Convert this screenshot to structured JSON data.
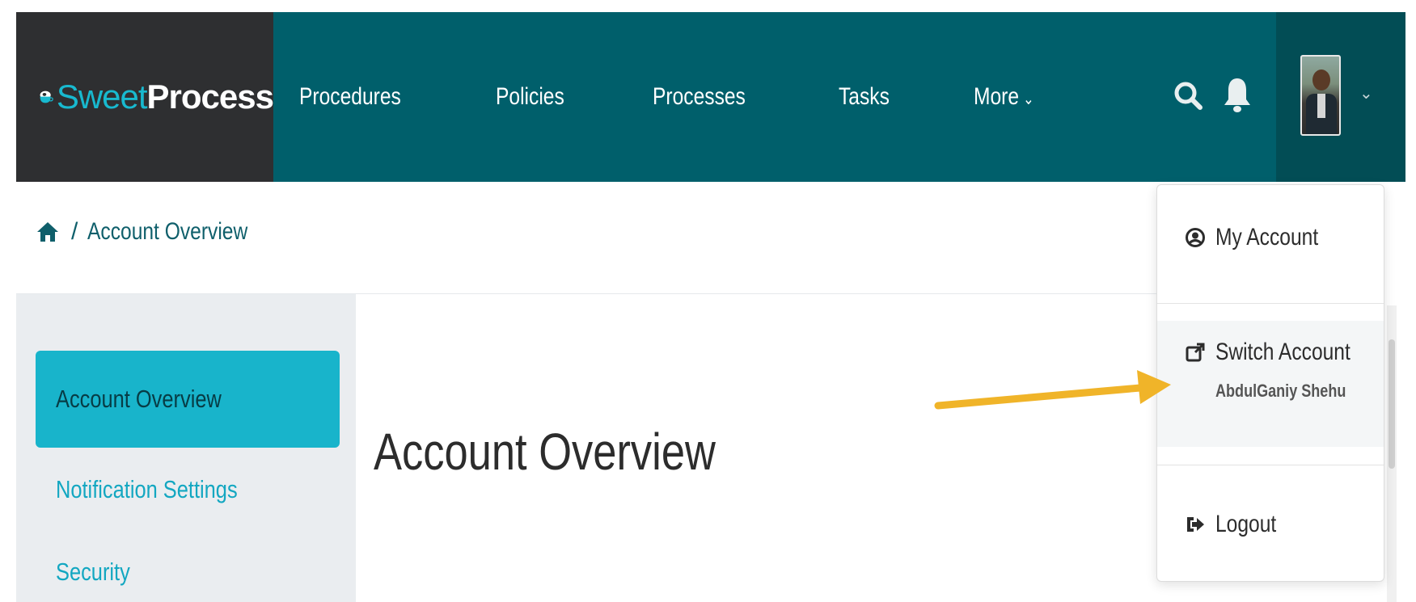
{
  "brand": {
    "name_part1": "Sweet",
    "name_part2": "Process",
    "logo_icon": "coffee-cup-icon"
  },
  "nav": {
    "items": [
      {
        "label": "Procedures"
      },
      {
        "label": "Policies"
      },
      {
        "label": "Processes"
      },
      {
        "label": "Tasks"
      },
      {
        "label": "More",
        "chevron": "⌄"
      }
    ]
  },
  "header_icons": {
    "search": "search-icon",
    "notifications": "bell-icon"
  },
  "user_menu": {
    "chevron": "⌄"
  },
  "breadcrumb": {
    "home_icon": "home-icon",
    "separator": "/",
    "current": "Account Overview"
  },
  "sidebar": {
    "items": [
      {
        "label": "Account Overview",
        "active": true
      },
      {
        "label": "Notification Settings"
      },
      {
        "label": "Security"
      }
    ]
  },
  "main": {
    "title": "Account Overview"
  },
  "dropdown": {
    "my_account": "My Account",
    "switch_account": "Switch Account",
    "switch_account_user": "AbdulGaniy Shehu",
    "logout": "Logout"
  },
  "colors": {
    "topbar": "#005f6b",
    "logo_bg": "#2e2f31",
    "accent": "#18b4cb",
    "annotation_arrow": "#f0b429"
  }
}
